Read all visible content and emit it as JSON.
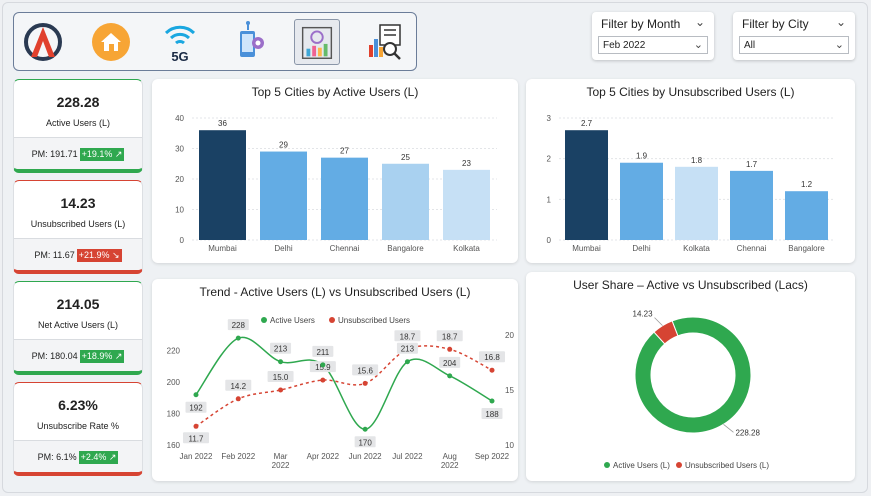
{
  "nav": {
    "items": [
      {
        "name": "logo-icon"
      },
      {
        "name": "home-icon"
      },
      {
        "name": "5g-icon",
        "text": "5G"
      },
      {
        "name": "phone-settings-icon"
      },
      {
        "name": "analytics-icon"
      },
      {
        "name": "report-search-icon"
      }
    ]
  },
  "filters": {
    "month": {
      "title": "Filter by Month",
      "value": "Feb 2022"
    },
    "city": {
      "title": "Filter by City",
      "value": "All"
    }
  },
  "kpis": [
    {
      "value": "228.28",
      "label": "Active Users (L)",
      "pm": "PM: 191.71",
      "change": "+19.1% ↗",
      "status": "good"
    },
    {
      "value": "14.23",
      "label": "Unsubscribed Users (L)",
      "pm": "PM: 11.67",
      "change": "+21.9% ↘",
      "status": "bad"
    },
    {
      "value": "214.05",
      "label": "Net Active Users (L)",
      "pm": "PM: 180.04",
      "change": "+18.9% ↗",
      "status": "good"
    },
    {
      "value": "6.23%",
      "label": "Unsubscribe Rate %",
      "pm": "PM: 6.1%",
      "change": "+2.4% ↗",
      "status": "bad"
    }
  ],
  "colors": {
    "dark_bar": "#1a4164",
    "mid_bar": "#63ace4",
    "light_bar": "#a9d1f0",
    "lighter_bar": "#c6e0f5",
    "active": "#2fa84f",
    "unsub": "#d64433"
  },
  "chart_data": [
    {
      "type": "bar",
      "title": "Top 5 Cities by Active Users (L)",
      "categories": [
        "Mumbai",
        "Delhi",
        "Chennai",
        "Bangalore",
        "Kolkata"
      ],
      "values": [
        36,
        29,
        27,
        25,
        23
      ],
      "labels": [
        "36",
        "29",
        "27",
        "25",
        "23"
      ],
      "ylim": [
        0,
        40
      ],
      "yticks": [
        "0",
        "10",
        "20",
        "30",
        "40"
      ],
      "grid": true
    },
    {
      "type": "bar",
      "title": "Top 5 Cities by Unsubscribed Users (L)",
      "categories": [
        "Mumbai",
        "Delhi",
        "Kolkata",
        "Chennai",
        "Bangalore"
      ],
      "values": [
        2.7,
        1.9,
        1.8,
        1.7,
        1.2
      ],
      "labels": [
        "2.7",
        "1.9",
        "1.8",
        "1.7",
        "1.2"
      ],
      "ylim": [
        0,
        3
      ],
      "yticks": [
        "0",
        "1",
        "2",
        "3"
      ],
      "grid": true
    },
    {
      "type": "line",
      "title": "Trend - Active Users (L) vs Unsubscribed Users (L)",
      "categories": [
        "Jan 2022",
        "Feb 2022",
        "Mar 2022",
        "Apr 2022",
        "Jun 2022",
        "Jul 2022",
        "Aug 2022",
        "Sep 2022"
      ],
      "series": [
        {
          "name": "Active Users",
          "values": [
            192,
            228,
            213,
            211,
            170,
            213,
            204,
            188
          ],
          "labels": [
            "192",
            "228",
            "213",
            "211",
            "170",
            "213",
            "204",
            "188"
          ],
          "axis": "left"
        },
        {
          "name": "Unsubscribed Users",
          "values": [
            11.7,
            14.2,
            15.0,
            15.9,
            15.6,
            18.7,
            18.7,
            16.8
          ],
          "labels": [
            "11.7",
            "14.2",
            "15.0",
            "15.9",
            "15.6",
            "18.7",
            "18.7",
            "16.8"
          ],
          "axis": "right"
        }
      ],
      "ylim_left": [
        160,
        230
      ],
      "yticks_left": [
        "160",
        "180",
        "200",
        "220"
      ],
      "ylim_right": [
        10,
        20
      ],
      "yticks_right": [
        "10",
        "15",
        "20"
      ],
      "legend": "top"
    },
    {
      "type": "pie",
      "title": "User Share – Active vs Unsubscribed (Lacs)",
      "categories": [
        "Active Users (L)",
        "Unsubscribed Users (L)"
      ],
      "values": [
        228.28,
        14.23
      ],
      "labels": [
        "228.28",
        "14.23"
      ],
      "legend": "bottom"
    }
  ]
}
